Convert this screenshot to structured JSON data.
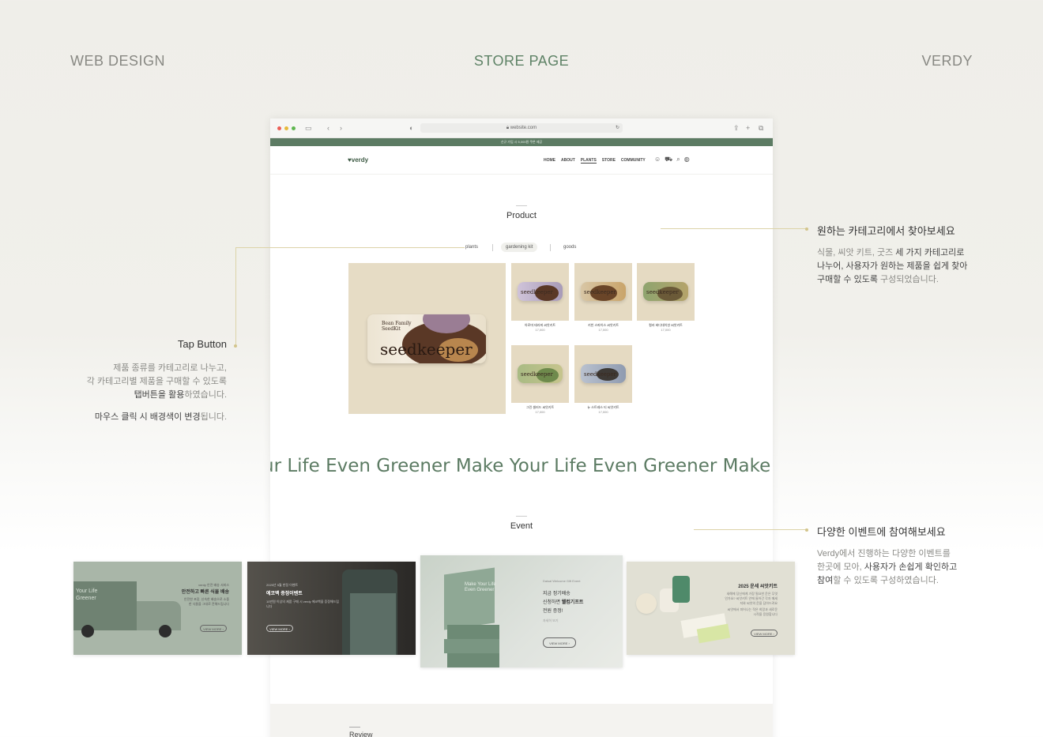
{
  "header": {
    "left": "WEB DESIGN",
    "center": "STORE PAGE",
    "right": "VERDY"
  },
  "browser": {
    "url": "website.com",
    "promo": "신규 가입 시 5,000원 쿠폰 제공",
    "logo": "verdy",
    "nav": [
      "HOME",
      "ABOUT",
      "PLANTS",
      "STORE",
      "COMMUNITY"
    ],
    "product_title": "Product",
    "tabs": [
      "plants",
      "gardening kit",
      "goods"
    ],
    "featured_pack": {
      "line1": "Bean Family",
      "line2": "SeedKit",
      "brand": "seedkeeper"
    },
    "products": [
      {
        "name": "아로마 테라피 씨앗키트",
        "price": "17,000"
      },
      {
        "name": "키친 스파이스 씨앗키트",
        "price": "17,000"
      },
      {
        "name": "컬러 버디대이션 씨앗키트",
        "price": "17,000"
      },
      {
        "name": "그린 샐러드 씨앗키트",
        "price": "17,000"
      },
      {
        "name": "뉴 스트레스 티 씨앗키트",
        "price": "17,000"
      }
    ],
    "marquee": "ur Life Even Greener   Make Your Life Even Greener   Make Your Li",
    "event_title": "Event",
    "review_title": "Review"
  },
  "events": [
    {
      "title": "안전하고 빠른 식물 배송",
      "label": "verdy 안전 배송 서비스",
      "desc": "안전한 포장, 신속한 배송으로 소중한 식물을 그대로 전해드립니다",
      "overlay": "Your Life Greener",
      "button": "VIEW MORE"
    },
    {
      "title": "에코백 증정이벤트",
      "label": "2025년 5월 한정 이벤트",
      "desc": "10만원 이상의 제품 구매 시 verdy 에코백을 증정해드립니다",
      "button": "VIEW MORE"
    },
    {
      "label": "Daisal Welcome Gift Event",
      "line1": "지금 정기배송",
      "line2a": "신청하면",
      "line2b": "웰컴기프트",
      "line3": "전원 증정!",
      "sub": "자세히 보기",
      "overlay": "Make Your Life Even Greener",
      "button": "VIEW MORE"
    },
    {
      "title": "2025 운세 씨앗키트",
      "desc": "새해에 당신에게 가장 필요한 운은 무엇인가요? 씨앗키트 안에 들어간 각자 메세지와 씨앗의 운을 담아드려요",
      "desc2": "씨앗에서 피어나는 작은 희망과 새로운 시작을 응원합니다",
      "button": "VIEW MORE"
    }
  ],
  "annotations": {
    "category": {
      "title": "원하는 카테고리에서 찾아보세요",
      "l1a": "식물, 씨앗 키트, 굿즈 ",
      "l1b": "세 가지 카테고리로",
      "l2": "나누어, 사용자가 원하는 제품을 쉽게 찾아",
      "l3a": "구매할 수 있도록",
      "l3b": " 구성되었습니다."
    },
    "tap": {
      "title": "Tap Button",
      "l1": "제품 종류를 카테고리로 나누고,",
      "l2": "각 카테고리별 제품을 구매할 수 있도록",
      "l3a": "탭버튼을 활용",
      "l3b": "하였습니다.",
      "l4a": "마우스 클릭 시 배경색이 변경",
      "l4b": "됩니다."
    },
    "event": {
      "title": "다양한 이벤트에 참여해보세요",
      "l1": "Verdy에서 진행하는 다양한 이벤트를",
      "l2a": "한곳에 모아, ",
      "l2b": "사용자가 손쉽게 확인하고",
      "l3a": "참여",
      "l3b": "할 수 있도록 구성하였습니다."
    }
  },
  "colors": {
    "brand": "#5c7b63",
    "accent_line": "#dcd3a8"
  }
}
